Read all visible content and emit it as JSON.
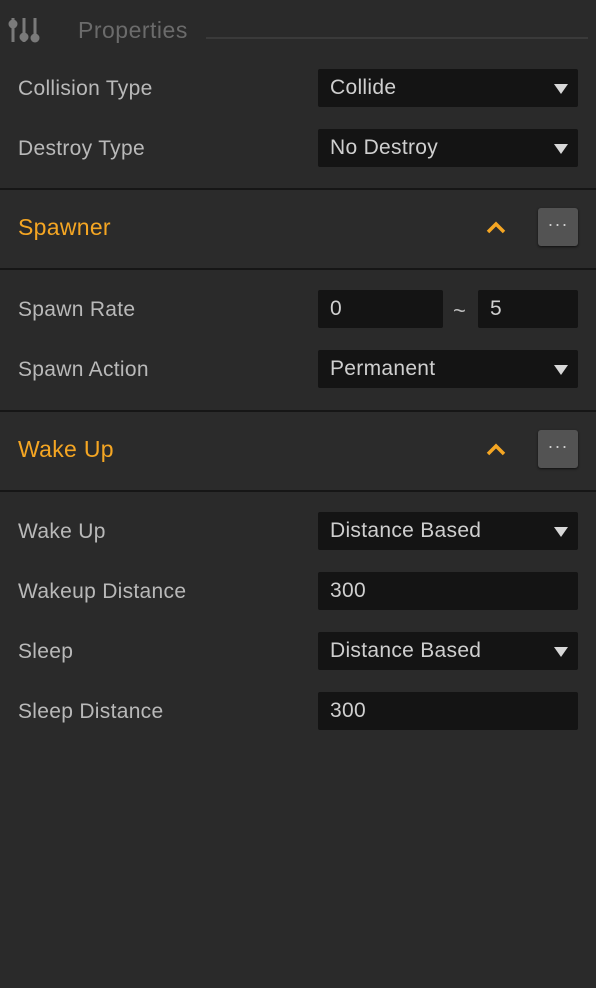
{
  "panel": {
    "title": "Properties"
  },
  "collision_type": {
    "label": "Collision Type",
    "value": "Collide"
  },
  "destroy_type": {
    "label": "Destroy Type",
    "value": "No Destroy"
  },
  "spawner": {
    "title": "Spawner",
    "more_label": "···",
    "spawn_rate": {
      "label": "Spawn Rate",
      "min": "0",
      "separator": "~",
      "max": "5"
    },
    "spawn_action": {
      "label": "Spawn Action",
      "value": "Permanent"
    }
  },
  "wake_up": {
    "title": "Wake Up",
    "more_label": "···",
    "wake_up": {
      "label": "Wake Up",
      "value": "Distance Based"
    },
    "wakeup_distance": {
      "label": "Wakeup Distance",
      "value": "300"
    },
    "sleep": {
      "label": "Sleep",
      "value": "Distance Based"
    },
    "sleep_distance": {
      "label": "Sleep Distance",
      "value": "300"
    }
  },
  "colors": {
    "accent": "#f5a623",
    "background": "#2a2a2a",
    "field": "#141414"
  }
}
